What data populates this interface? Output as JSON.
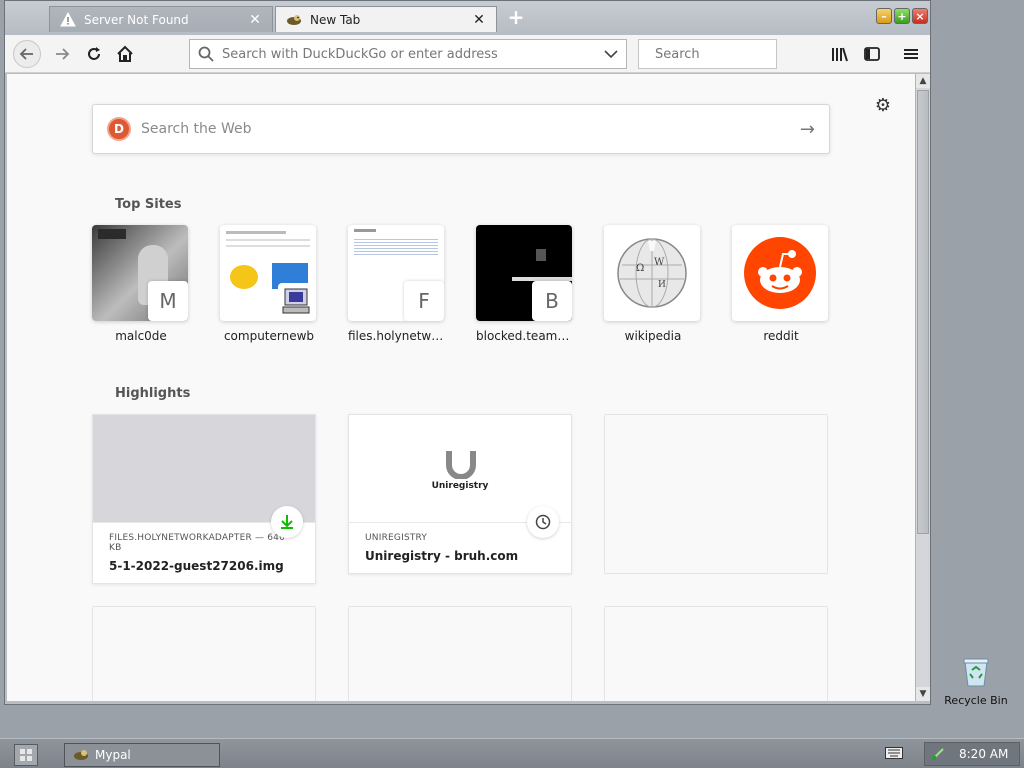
{
  "tabs": [
    {
      "title": "Server Not Found",
      "icon": "warning-icon",
      "active": false
    },
    {
      "title": "New Tab",
      "icon": "mypal-icon",
      "active": true
    }
  ],
  "toolbar": {
    "url_placeholder": "Search with DuckDuckGo or enter address",
    "search_placeholder": "Search"
  },
  "newtab": {
    "websearch_placeholder": "Search the Web",
    "top_sites_title": "Top Sites",
    "highlights_title": "Highlights",
    "top_sites": [
      {
        "label": "malc0de",
        "badge": "M"
      },
      {
        "label": "computernewb",
        "badge": ""
      },
      {
        "label": "files.holynetwo...",
        "badge": "F"
      },
      {
        "label": "blocked.teams....",
        "badge": "B"
      },
      {
        "label": "wikipedia",
        "badge": ""
      },
      {
        "label": "reddit",
        "badge": ""
      }
    ],
    "highlights": [
      {
        "source": "FILES.HOLYNETWORKADAPTER — 640 KB",
        "title": "5-1-2022-guest27206.img",
        "badge_icon": "download-icon"
      },
      {
        "source": "UNIREGISTRY",
        "title": "Uniregistry - bruh.com",
        "badge_icon": "clock-icon",
        "logo_text": "Uniregistry"
      }
    ]
  },
  "desktop": {
    "recycle_label": "Recycle Bin"
  },
  "taskbar": {
    "task_label": "Mypal",
    "clock": "8:20 AM"
  },
  "colors": {
    "ddg": "#de5833",
    "reddit": "#ff4500",
    "download": "#12bc00"
  }
}
